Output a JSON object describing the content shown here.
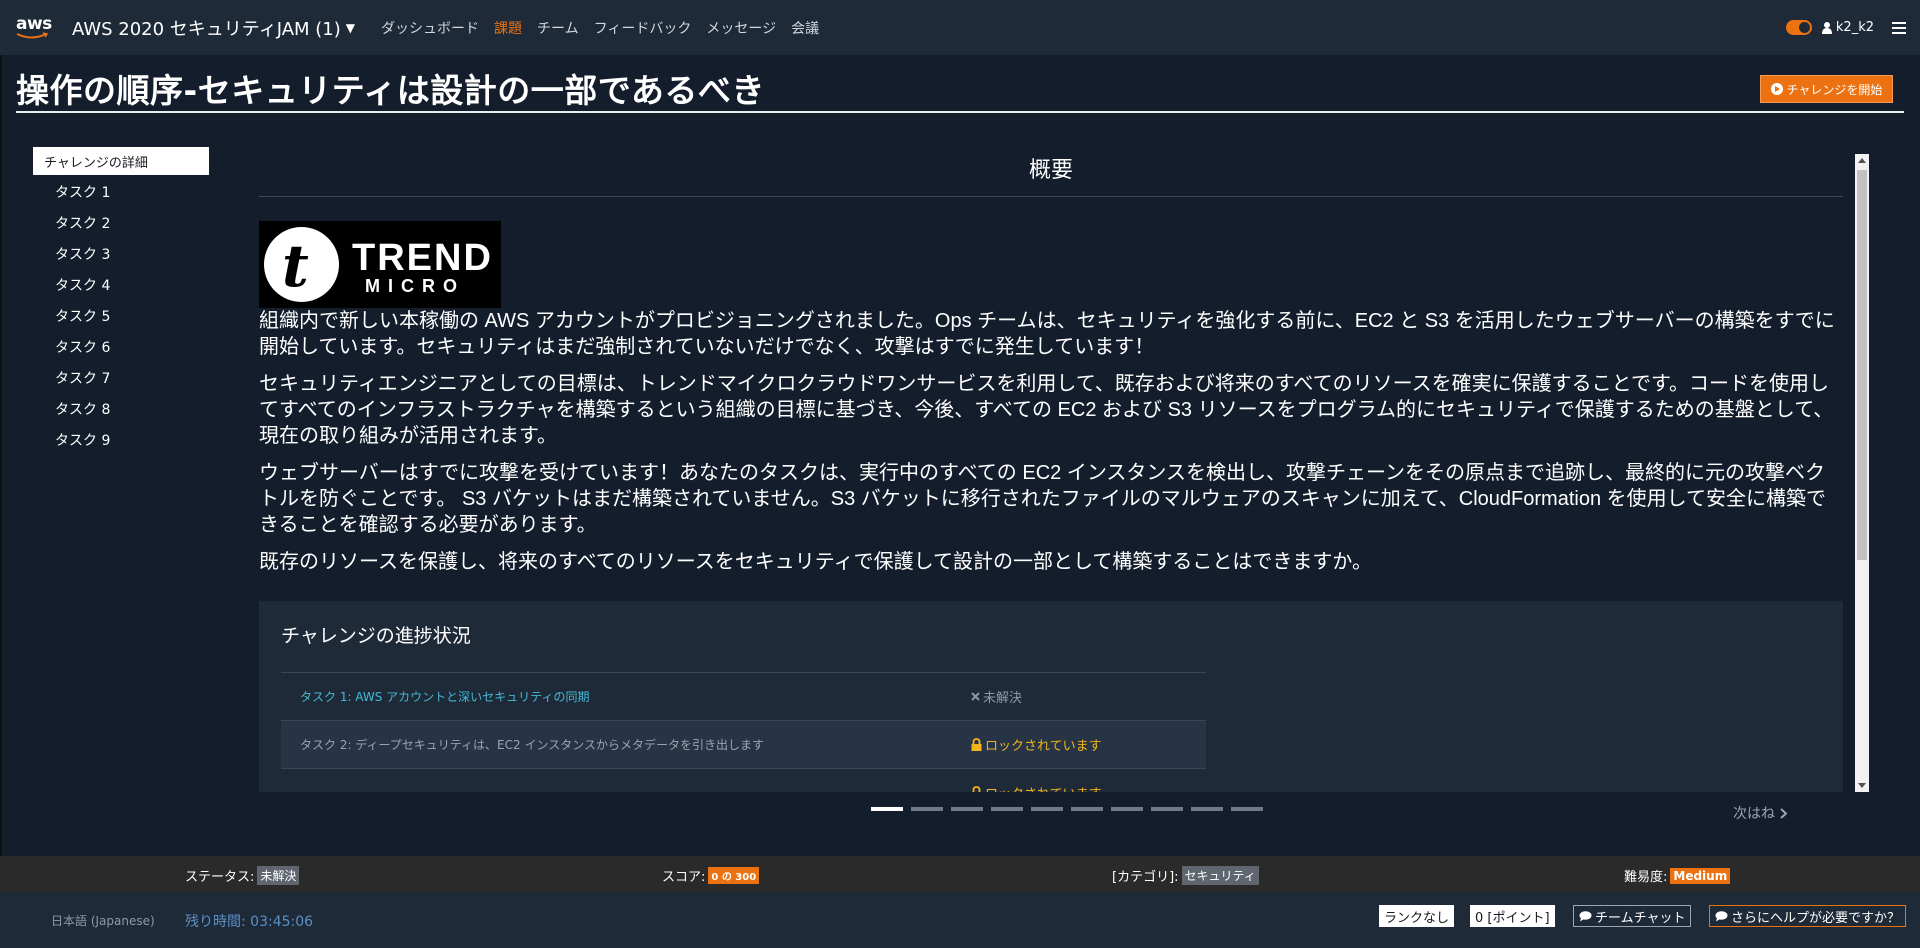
{
  "nav": {
    "logo_text": "aws",
    "brand": "AWS 2020 セキュリティJAM (1)",
    "links": [
      "ダッシュボード",
      "課題",
      "チーム",
      "フィードバック",
      "メッセージ",
      "会議"
    ],
    "active_link": "課題",
    "username": "k2_k2"
  },
  "page": {
    "title": "操作の順序-セキュリティは設計の一部であるべき",
    "start_button": "チャレンジを開始"
  },
  "sidebar": {
    "items": [
      {
        "label": "チャレンジの詳細"
      },
      {
        "label": "タスク 1"
      },
      {
        "label": "タスク 2"
      },
      {
        "label": "タスク 3"
      },
      {
        "label": "タスク 4"
      },
      {
        "label": "タスク 5"
      },
      {
        "label": "タスク 6"
      },
      {
        "label": "タスク 7"
      },
      {
        "label": "タスク 8"
      },
      {
        "label": "タスク 9"
      }
    ]
  },
  "content": {
    "heading": "概要",
    "logo": {
      "line1": "TREND",
      "line2": "MICRO",
      "tm": "™"
    },
    "paragraphs": [
      "組織内で新しい本稼働の AWS アカウントがプロビジョニングされました。Ops チームは、セキュリティを強化する前に、EC2 と S3 を活用したウェブサーバーの構築をすでに開始しています。セキュリティはまだ強制されていないだけでなく、攻撃はすでに発生しています！",
      "セキュリティエンジニアとしての目標は、トレンドマイクロクラウドワンサービスを利用して、既存および将来のすべてのリソースを確実に保護することです。コードを使用してすべてのインフラストラクチャを構築するという組織の目標に基づき、今後、すべての EC2 および S3 リソースをプログラム的にセキュリティで保護するための基盤として、現在の取り組みが活用されます。",
      "ウェブサーバーはすでに攻撃を受けています！あなたのタスクは、実行中のすべての EC2 インスタンスを検出し、攻撃チェーンをその原点まで追跡し、最終的に元の攻撃ベクトルを防ぐことです。 S3 バケットはまだ構築されていません。S3 バケットに移行されたファイルのマルウェアのスキャンに加えて、CloudFormation を使用して安全に構築できることを確認する必要があります。",
      "既存のリソースを保護し、将来のすべてのリソースをセキュリティで保護して設計の一部として構築することはできますか。"
    ],
    "progress": {
      "title": "チャレンジの進捗状況",
      "tasks": [
        {
          "name": "タスク 1: AWS アカウントと深いセキュリティの同期",
          "status": "未解決"
        },
        {
          "name": "タスク 2: ディープセキュリティは、EC2 インスタンスからメタデータを引き出します",
          "status": "ロックされています"
        },
        {
          "name": "",
          "status": "ロックされています"
        }
      ]
    },
    "pager": {
      "total": 10,
      "current": 1
    },
    "next_label": "次はね"
  },
  "status_strip": {
    "status_label": "ステータス:",
    "status_value": "未解決",
    "score_label": "スコア:",
    "score_value": "0 の 300",
    "category_label": "[カテゴリ]:",
    "category_value": "セキュリティ",
    "difficulty_label": "難易度:",
    "difficulty_value": "Medium"
  },
  "footer": {
    "language": "日本語 (Japanese)",
    "time_remaining": "残り時間: 03:45:06",
    "rank": "ランクなし",
    "points": "0 [ポイント]",
    "team_chat": "チームチャット",
    "help": "さらにヘルプが必要ですか？"
  },
  "colors": {
    "accent": "#ec7211",
    "background": "#131d2b",
    "nav": "#1e2a38",
    "link": "#44b9d6",
    "locked": "#f2b51b"
  },
  "icons": {
    "brand_caret": "caret-down-icon",
    "user": "user-icon",
    "menu": "hamburger-menu-icon",
    "start": "play-circle-icon",
    "unsolved": "x-icon",
    "locked": "lock-icon",
    "next": "chevron-right-icon",
    "chat": "chat-bubble-icon"
  }
}
